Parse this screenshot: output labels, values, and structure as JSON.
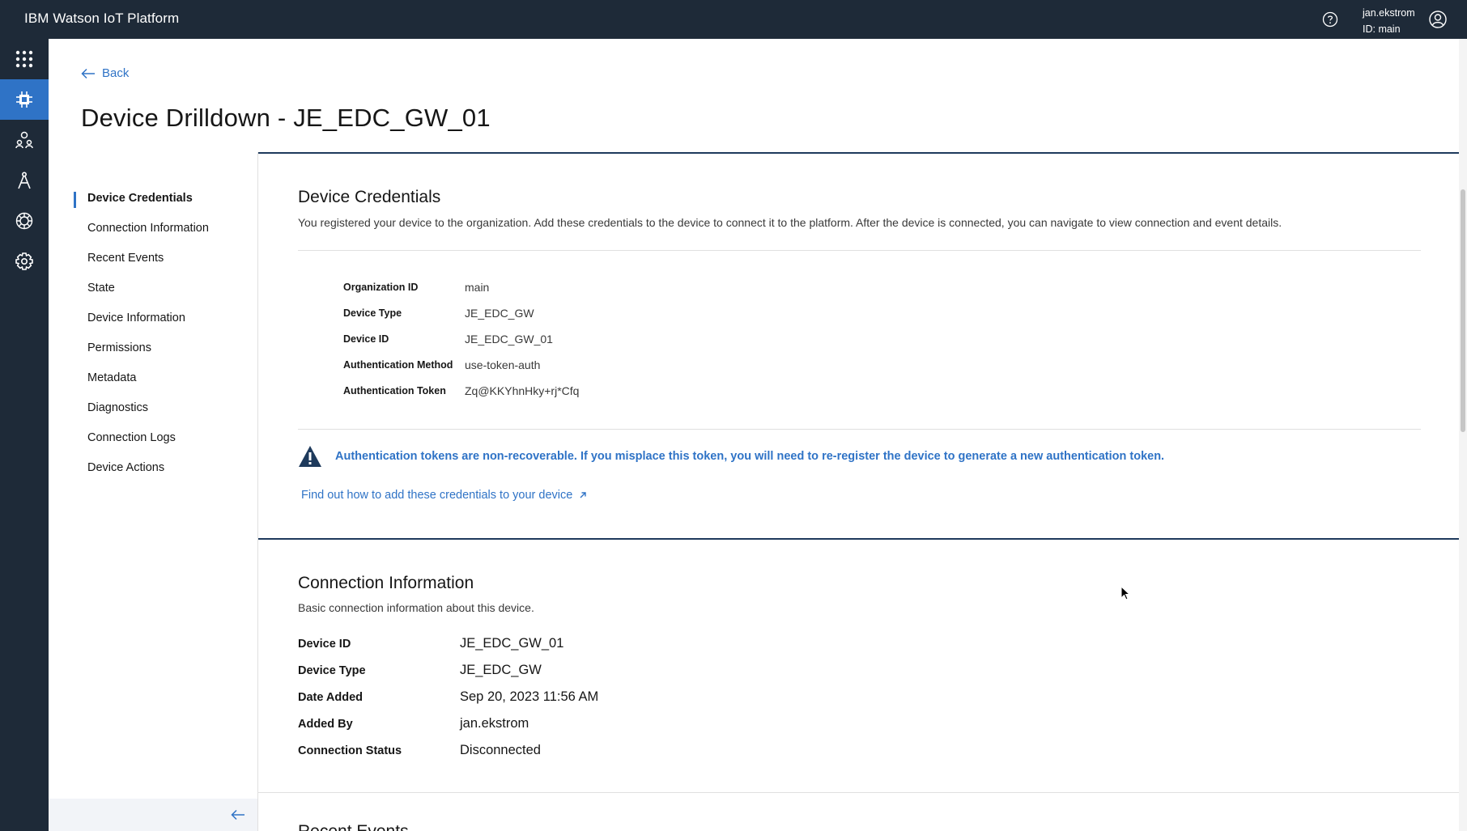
{
  "topbar": {
    "brand": "IBM Watson IoT Platform",
    "user_name": "jan.ekstrom",
    "user_id": "ID: main"
  },
  "header": {
    "back_label": "Back",
    "title": "Device Drilldown - JE_EDC_GW_01"
  },
  "nav": {
    "items": [
      {
        "label": "Device Credentials",
        "active": true
      },
      {
        "label": "Connection Information",
        "active": false
      },
      {
        "label": "Recent Events",
        "active": false
      },
      {
        "label": "State",
        "active": false
      },
      {
        "label": "Device Information",
        "active": false
      },
      {
        "label": "Permissions",
        "active": false
      },
      {
        "label": "Metadata",
        "active": false
      },
      {
        "label": "Diagnostics",
        "active": false
      },
      {
        "label": "Connection Logs",
        "active": false
      },
      {
        "label": "Device Actions",
        "active": false
      }
    ]
  },
  "credentials": {
    "title": "Device Credentials",
    "description": "You registered your device to the organization. Add these credentials to the device to connect it to the platform. After the device is connected, you can navigate to view connection and event details.",
    "rows": [
      {
        "label": "Organization ID",
        "value": "main"
      },
      {
        "label": "Device Type",
        "value": "JE_EDC_GW"
      },
      {
        "label": "Device ID",
        "value": "JE_EDC_GW_01"
      },
      {
        "label": "Authentication Method",
        "value": "use-token-auth"
      },
      {
        "label": "Authentication Token",
        "value": "Zq@KKYhnHky+rj*Cfq"
      }
    ],
    "warning": "Authentication tokens are non-recoverable. If you misplace this token, you will need to re-register the device to generate a new authentication token.",
    "link": "Find out how to add these credentials to your device"
  },
  "connection": {
    "title": "Connection Information",
    "description": "Basic connection information about this device.",
    "rows": [
      {
        "label": "Device ID",
        "value": "JE_EDC_GW_01"
      },
      {
        "label": "Device Type",
        "value": "JE_EDC_GW"
      },
      {
        "label": "Date Added",
        "value": "Sep 20, 2023 11:56 AM"
      },
      {
        "label": "Added By",
        "value": "jan.ekstrom"
      },
      {
        "label": "Connection Status",
        "value": "Disconnected"
      }
    ]
  },
  "next_section": {
    "title": "Recent Events"
  },
  "colors": {
    "topbar": "#1e2a38",
    "accent": "#2f73c6",
    "rule": "#1e3a5c"
  },
  "icons": {
    "rail": [
      "app-switcher-icon",
      "devices-icon",
      "members-icon",
      "apps-icon",
      "rules-icon",
      "settings-icon"
    ],
    "topbar": [
      "help-icon",
      "user-avatar-icon"
    ],
    "other": [
      "back-arrow-icon",
      "warning-icon",
      "external-link-icon",
      "collapse-arrow-icon"
    ]
  }
}
